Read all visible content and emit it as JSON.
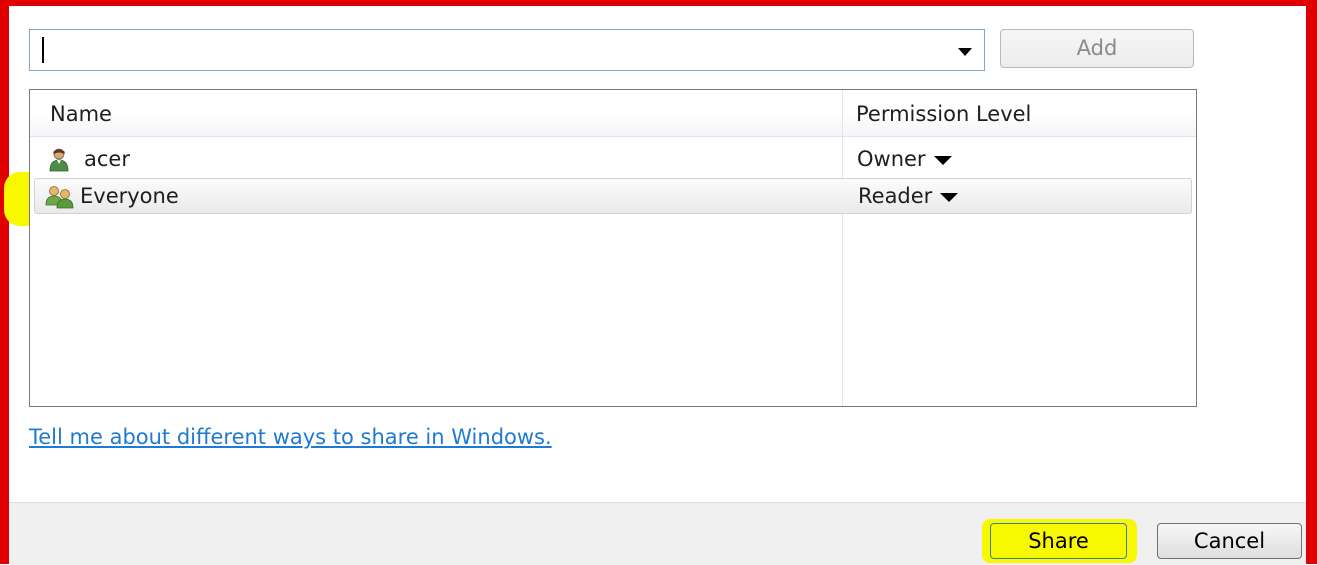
{
  "name_combo": {
    "value": ""
  },
  "add_button": {
    "label": "Add"
  },
  "list": {
    "columns": {
      "name": "Name",
      "permission": "Permission Level"
    },
    "rows": [
      {
        "name": "acer",
        "permission": "Owner",
        "icon": "user-icon"
      },
      {
        "name": "Everyone",
        "permission": "Reader",
        "icon": "group-icon",
        "selected": true,
        "highlighted": true
      }
    ]
  },
  "help_link": {
    "text": "Tell me about different ways to share in Windows."
  },
  "footer": {
    "share_label": "Share",
    "cancel_label": "Cancel"
  },
  "colors": {
    "frame": "#e00000",
    "highlight": "#f8f800",
    "link": "#1f7ad1"
  }
}
